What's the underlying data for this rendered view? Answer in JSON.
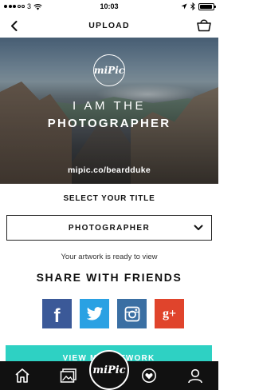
{
  "status_bar": {
    "carrier_number": "3",
    "time": "10:03",
    "battery_level": 0.95
  },
  "nav": {
    "title": "UPLOAD",
    "back_icon": "back-arrow-icon",
    "basket_icon": "basket-icon"
  },
  "hero": {
    "logo_text": "miPic",
    "line1": "I AM THE",
    "line2": "PHOTOGRAPHER",
    "url": "mipic.co/beardduke"
  },
  "title_select": {
    "label": "SELECT YOUR TITLE",
    "selected_value": "PHOTOGRAPHER"
  },
  "ready_text": "Your artwork is ready to view",
  "share": {
    "heading": "SHARE WITH FRIENDS",
    "buttons": [
      {
        "icon": "facebook-icon",
        "glyph": "f",
        "color": "#3b5998"
      },
      {
        "icon": "twitter-icon",
        "color": "#2aa1e3"
      },
      {
        "icon": "instagram-icon",
        "color": "#3a6fa3"
      },
      {
        "icon": "google-plus-icon",
        "glyph": "g+",
        "color": "#e0442c"
      }
    ]
  },
  "view_button": {
    "label": "VIEW MY ARTWORK",
    "color": "#2ed1c3"
  },
  "tab_bar": {
    "center_logo": "miPic",
    "tabs": [
      "home-icon",
      "gallery-icon",
      "mipic-logo",
      "favourites-icon",
      "profile-icon"
    ]
  }
}
